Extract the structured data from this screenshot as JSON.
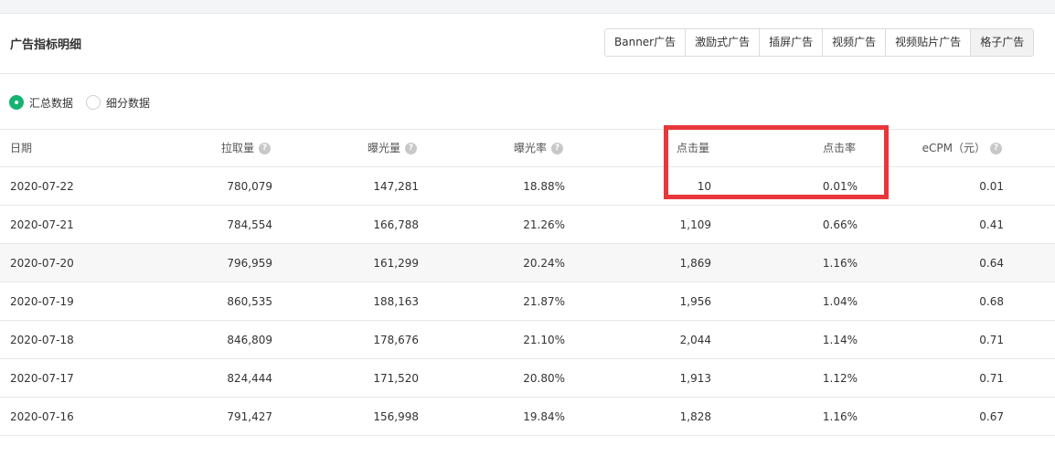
{
  "header": {
    "title": "广告指标明细"
  },
  "tabs": [
    {
      "label": "Banner广告",
      "active": false
    },
    {
      "label": "激励式广告",
      "active": false
    },
    {
      "label": "插屏广告",
      "active": false
    },
    {
      "label": "视频广告",
      "active": false
    },
    {
      "label": "视频贴片广告",
      "active": false
    },
    {
      "label": "格子广告",
      "active": true
    }
  ],
  "view_mode": {
    "options": [
      {
        "label": "汇总数据",
        "checked": true
      },
      {
        "label": "细分数据",
        "checked": false
      }
    ]
  },
  "table": {
    "columns": [
      "日期",
      "拉取量",
      "曝光量",
      "曝光率",
      "点击量",
      "点击率",
      "eCPM（元）"
    ],
    "help_icon_glyph": "?",
    "rows": [
      [
        "2020-07-22",
        "780,079",
        "147,281",
        "18.88%",
        "10",
        "0.01%",
        "0.01"
      ],
      [
        "2020-07-21",
        "784,554",
        "166,788",
        "21.26%",
        "1,109",
        "0.66%",
        "0.41"
      ],
      [
        "2020-07-20",
        "796,959",
        "161,299",
        "20.24%",
        "1,869",
        "1.16%",
        "0.64"
      ],
      [
        "2020-07-19",
        "860,535",
        "188,163",
        "21.87%",
        "1,956",
        "1.04%",
        "0.68"
      ],
      [
        "2020-07-18",
        "846,809",
        "178,676",
        "21.10%",
        "2,044",
        "1.14%",
        "0.71"
      ],
      [
        "2020-07-17",
        "824,444",
        "171,520",
        "20.80%",
        "1,913",
        "1.12%",
        "0.71"
      ],
      [
        "2020-07-16",
        "791,427",
        "156,998",
        "19.84%",
        "1,828",
        "1.16%",
        "0.67"
      ]
    ]
  },
  "colors": {
    "accent_green": "#15b371",
    "highlight_red": "#e8373a"
  }
}
